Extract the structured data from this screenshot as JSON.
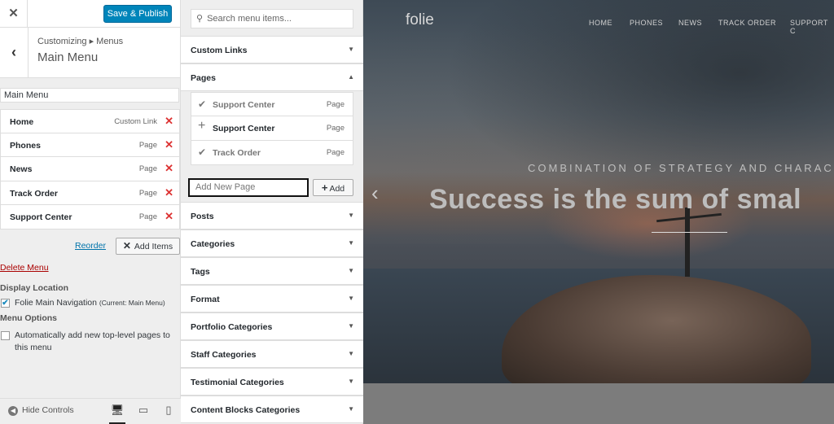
{
  "header": {
    "close_icon": "✕",
    "publish_label": "Save & Publish"
  },
  "panel": {
    "crumbs": "Customizing ▸ Menus",
    "title": "Main Menu",
    "back_icon": "‹"
  },
  "menu": {
    "name_value": "Main Menu",
    "items": [
      {
        "name": "Home",
        "type": "Custom Link"
      },
      {
        "name": "Phones",
        "type": "Page"
      },
      {
        "name": "News",
        "type": "Page"
      },
      {
        "name": "Track Order",
        "type": "Page"
      },
      {
        "name": "Support Center",
        "type": "Page"
      }
    ],
    "remove_glyph": "✕",
    "reorder_label": "Reorder",
    "add_items_icon": "✕",
    "add_items_label": "Add Items",
    "delete_label": "Delete Menu",
    "display_location_heading": "Display Location",
    "location_label": "Folie Main Navigation",
    "location_note": "(Current: Main Menu)",
    "menu_options_heading": "Menu Options",
    "auto_add_label": "Automatically add new top-level pages to this menu"
  },
  "footer": {
    "hide_controls_label": "Hide Controls"
  },
  "items_panel": {
    "search_placeholder": "Search menu items...",
    "sections": [
      "Custom Links",
      "Pages",
      "Posts",
      "Categories",
      "Tags",
      "Format",
      "Portfolio Categories",
      "Staff Categories",
      "Testimonial Categories",
      "Content Blocks Categories"
    ],
    "pages": [
      {
        "glyph": "✔",
        "name": "Support Center",
        "type": "Page",
        "added": true
      },
      {
        "glyph": "+",
        "name": "Support Center",
        "type": "Page",
        "added": false
      },
      {
        "glyph": "✔",
        "name": "Track Order",
        "type": "Page",
        "added": true
      }
    ],
    "new_page_placeholder": "Add New Page",
    "add_label": "Add"
  },
  "preview": {
    "logo": "folie",
    "nav": [
      "HOME",
      "PHONES",
      "NEWS",
      "TRACK ORDER",
      "SUPPORT C"
    ],
    "tagline": "COMBINATION OF STRATEGY AND CHARACT",
    "headline": "Success is the sum of smal",
    "prev_icon": "‹"
  },
  "colors": {
    "primary": "#0085ba",
    "danger": "#dc3232",
    "link": "#0073aa"
  }
}
